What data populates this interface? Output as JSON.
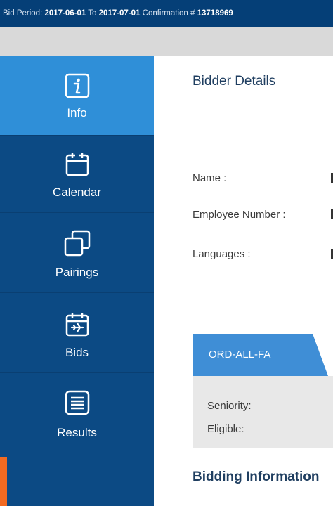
{
  "topbar": {
    "bid_period_label": "Bid Period: ",
    "bid_period_start": "2017-06-01",
    "to_label": " To ",
    "bid_period_end": "2017-07-01",
    "confirmation_label": " Confirmation # ",
    "confirmation_number": "13718969"
  },
  "sidebar": {
    "items": [
      {
        "label": "Info",
        "icon": "info-icon",
        "active": true
      },
      {
        "label": "Calendar",
        "icon": "calendar-icon",
        "active": false
      },
      {
        "label": "Pairings",
        "icon": "pairings-icon",
        "active": false
      },
      {
        "label": "Bids",
        "icon": "bids-calendar-plane-icon",
        "active": false
      },
      {
        "label": "Results",
        "icon": "results-list-icon",
        "active": false
      }
    ]
  },
  "main": {
    "title": "Bidder Details",
    "fields": [
      {
        "label": "Name :"
      },
      {
        "label": "Employee Number :"
      },
      {
        "label": "Languages :"
      }
    ],
    "tab": {
      "label": "ORD-ALL-FA"
    },
    "panel": {
      "seniority_label": "Seniority:",
      "eligible_label": "Eligible:"
    },
    "bidding_title": "Bidding Information"
  },
  "colors": {
    "topbar": "#053f77",
    "sidebar": "#0c4a84",
    "active": "#2f8fd8",
    "accent": "#f26a21",
    "tab": "#3f8ed6"
  }
}
